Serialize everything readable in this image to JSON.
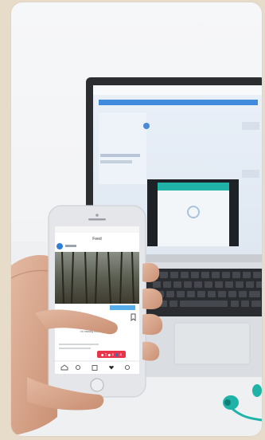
{
  "scene": {
    "background_color": "#e7dcc9",
    "photo_background": "#f3f4f6",
    "accent_blue": "#2f7fd8",
    "accent_teal": "#1fb3a8",
    "notification_red": "#e8334a"
  },
  "phone": {
    "app_title": "Feed",
    "caption": "i'm missing the the woods",
    "notification_badge": "● 1  ● 4  👤 4",
    "icons": [
      "heart-icon",
      "comment-icon",
      "share-icon",
      "bookmark-icon",
      "home-icon",
      "search-icon",
      "add-icon",
      "activity-icon",
      "profile-icon"
    ]
  },
  "laptop": {
    "screen_brand": "",
    "keyboard": "visible"
  },
  "earbuds": {
    "color": "#1fb3a8"
  }
}
